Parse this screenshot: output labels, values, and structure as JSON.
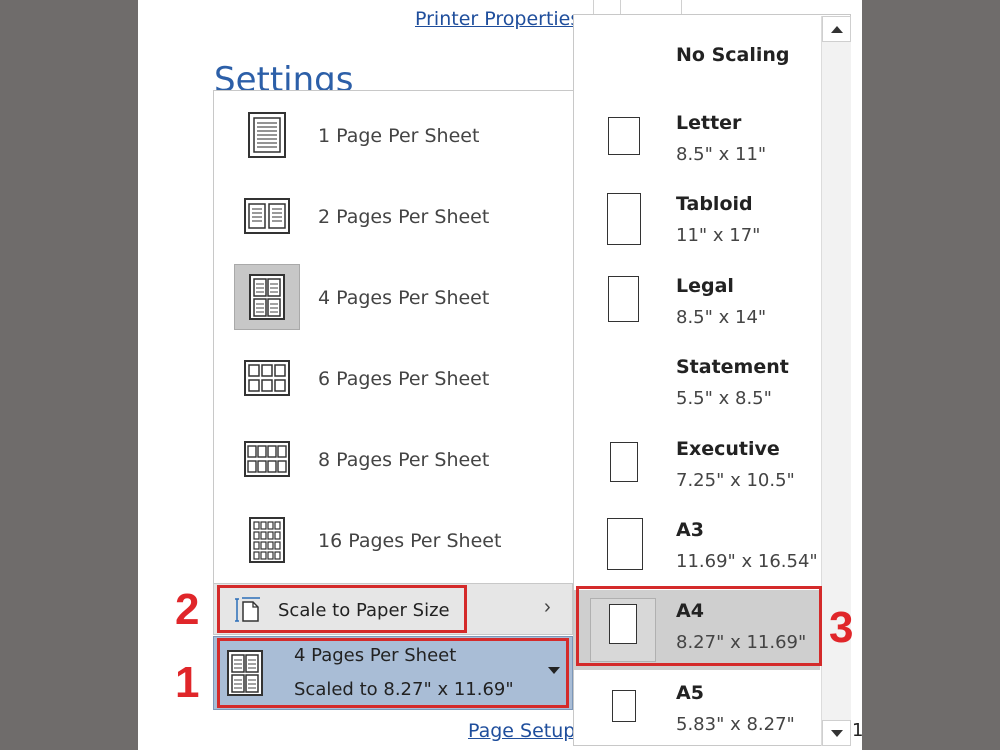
{
  "header": {
    "printer_properties": "Printer Properties",
    "settings_title": "Settings"
  },
  "pages_per_sheet": {
    "items": [
      {
        "label": "1 Page Per Sheet",
        "icon": "one-page-icon"
      },
      {
        "label": "2 Pages Per Sheet",
        "icon": "two-pages-icon"
      },
      {
        "label": "4 Pages Per Sheet",
        "icon": "four-pages-icon",
        "selected": true
      },
      {
        "label": "6 Pages Per Sheet",
        "icon": "six-pages-icon"
      },
      {
        "label": "8 Pages Per Sheet",
        "icon": "eight-pages-icon"
      },
      {
        "label": "16 Pages Per Sheet",
        "icon": "sixteen-pages-icon"
      }
    ],
    "scale_to_paper": "Scale to Paper Size",
    "current_line1": "4 Pages Per Sheet",
    "current_line2": "Scaled to 8.27\" x 11.69\""
  },
  "paper_sizes": {
    "no_scaling": "No Scaling",
    "items": [
      {
        "name": "Letter",
        "dims": "8.5\" x 11\""
      },
      {
        "name": "Tabloid",
        "dims": "11\" x 17\""
      },
      {
        "name": "Legal",
        "dims": "8.5\" x 14\""
      },
      {
        "name": "Statement",
        "dims": "5.5\" x 8.5\""
      },
      {
        "name": "Executive",
        "dims": "7.25\" x 10.5\""
      },
      {
        "name": "A3",
        "dims": "11.69\" x 16.54\""
      },
      {
        "name": "A4",
        "dims": "8.27\" x 11.69\"",
        "selected": true
      },
      {
        "name": "A5",
        "dims": "5.83\" x 8.27\""
      }
    ]
  },
  "footer": {
    "page_setup": "Page Setup",
    "trailing": "1"
  },
  "annotations": {
    "a1": "1",
    "a2": "2",
    "a3": "3"
  },
  "colors": {
    "annotation_red": "#d42a2a",
    "selection_blue": "#a9bdd6",
    "link_blue": "#1f4e9c"
  }
}
